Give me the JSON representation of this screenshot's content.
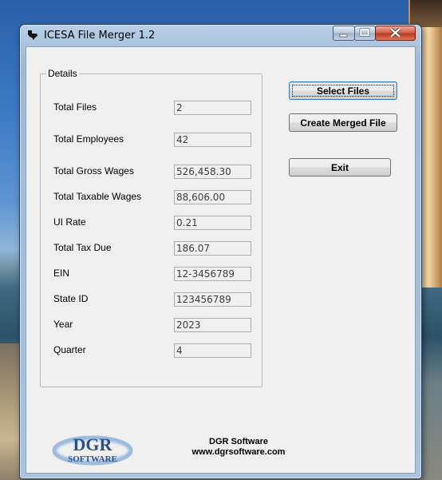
{
  "window": {
    "title": "ICESA File Merger  1.2",
    "app_icon": "texas-icon",
    "controls": {
      "minimize": "minimize-icon",
      "maximize": "maximize-icon",
      "close": "close-icon"
    }
  },
  "details": {
    "legend": "Details",
    "fields": [
      {
        "label": "Total Files",
        "value": "2"
      },
      {
        "label": "Total Employees",
        "value": "42"
      },
      {
        "label": "Total Gross Wages",
        "value": "526,458.30"
      },
      {
        "label": "Total Taxable Wages",
        "value": "88,606.00"
      },
      {
        "label": "UI Rate",
        "value": "0.21"
      },
      {
        "label": "Total Tax Due",
        "value": "186.07"
      },
      {
        "label": "EIN",
        "value": "12-3456789"
      },
      {
        "label": "State ID",
        "value": "123456789"
      },
      {
        "label": "Year",
        "value": "2023"
      },
      {
        "label": "Quarter",
        "value": "4"
      }
    ]
  },
  "buttons": {
    "select_files": "Select Files",
    "create_merged_file": "Create Merged File",
    "exit": "Exit"
  },
  "company": {
    "logo_text_top": "DGR",
    "logo_text_bottom": "SOFTWARE",
    "name": "DGR Software",
    "url": "www.dgrsoftware.com"
  },
  "colors": {
    "logo_blue": "#2b4f8c",
    "logo_swoosh": "#8fb3d9",
    "title_bar": "#a9c2dd"
  }
}
